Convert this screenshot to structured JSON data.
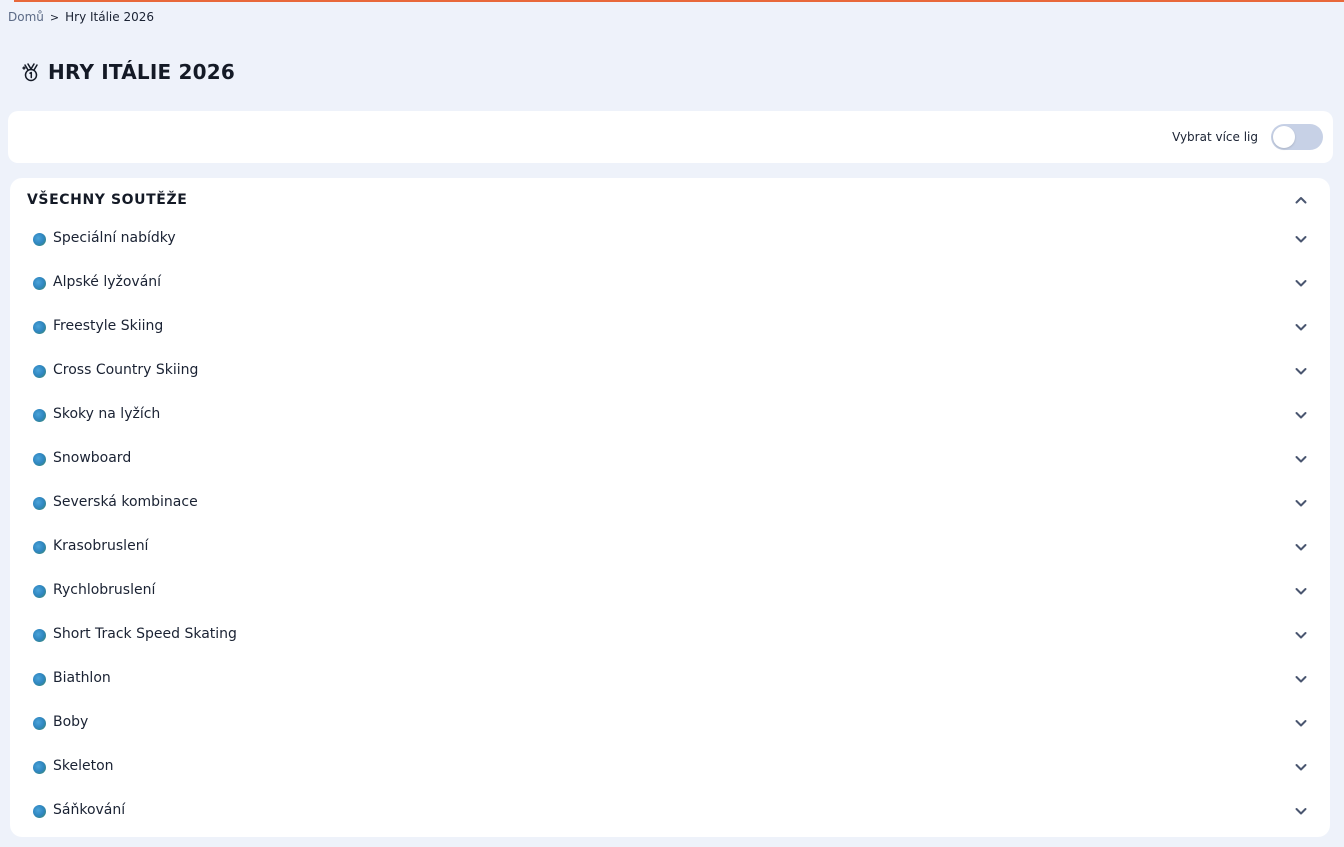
{
  "breadcrumb": {
    "home": "Domů",
    "separator": ">",
    "current": "Hry Itálie 2026"
  },
  "page": {
    "title": "HRY ITÁLIE 2026",
    "title_icon": "medal-icon"
  },
  "filter": {
    "toggle_label": "Vybrat více lig",
    "toggle_on": false
  },
  "competitions": {
    "header": "VŠECHNY SOUTĚŽE",
    "expanded": true,
    "items": [
      {
        "label": "Speciální nabídky"
      },
      {
        "label": "Alpské lyžování"
      },
      {
        "label": "Freestyle Skiing"
      },
      {
        "label": "Cross Country Skiing"
      },
      {
        "label": "Skoky na lyžích"
      },
      {
        "label": "Snowboard"
      },
      {
        "label": "Severská kombinace"
      },
      {
        "label": "Krasobruslení"
      },
      {
        "label": "Rychlobruslení"
      },
      {
        "label": "Short Track Speed Skating"
      },
      {
        "label": "Biathlon"
      },
      {
        "label": "Boby"
      },
      {
        "label": "Skeleton"
      },
      {
        "label": "Sáňkování"
      }
    ]
  },
  "colors": {
    "accent_line": "#e8683a",
    "background": "#eef2fa",
    "toggle_track": "#c7d1e6",
    "globe": "#2f86c0"
  }
}
